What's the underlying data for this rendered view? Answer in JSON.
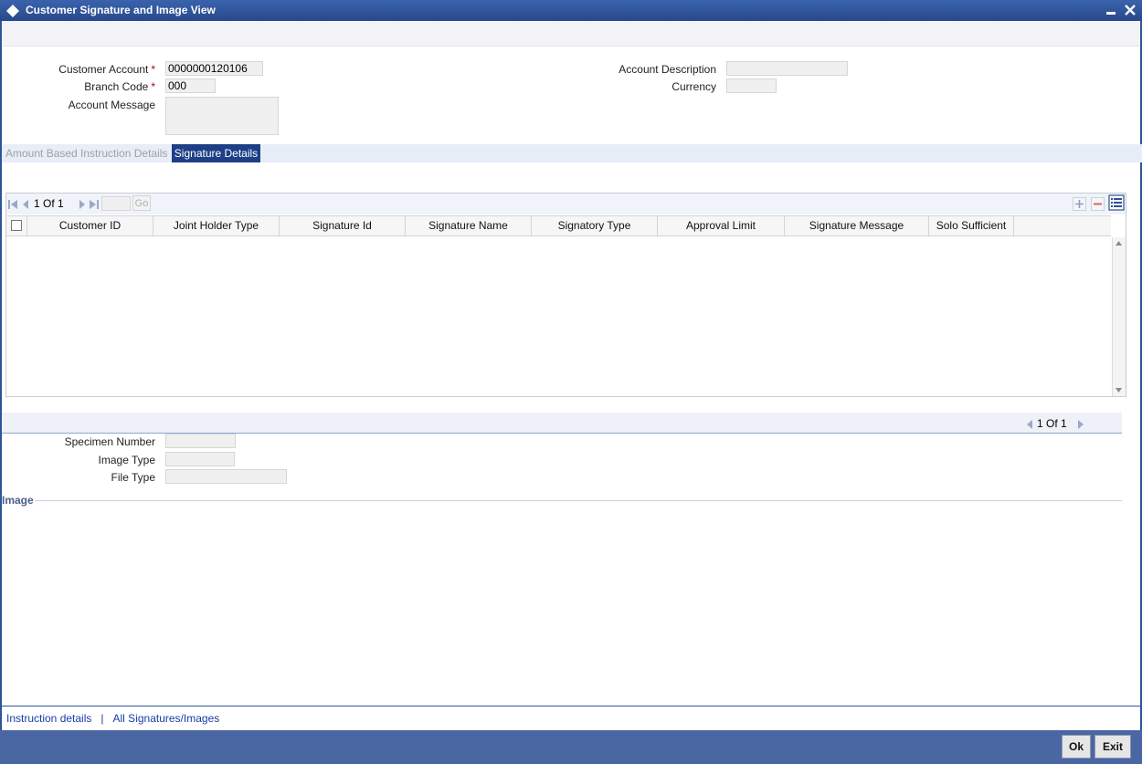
{
  "window": {
    "title": "Customer Signature and Image View",
    "accent_color": "#2f5597"
  },
  "form": {
    "customer_account": {
      "label": "Customer Account",
      "value": "0000000120106",
      "required_mark": "*"
    },
    "branch_code": {
      "label": "Branch Code",
      "value": "000",
      "required_mark": "*"
    },
    "account_message": {
      "label": "Account Message",
      "value": ""
    },
    "account_description": {
      "label": "Account Description",
      "value": ""
    },
    "currency": {
      "label": "Currency",
      "value": ""
    }
  },
  "tabs": [
    {
      "label": "Amount Based Instruction Details",
      "active": false
    },
    {
      "label": "Signature Details",
      "active": true
    }
  ],
  "grid": {
    "page_current": "1",
    "page_of": "Of",
    "page_total": "1",
    "page_input": "",
    "go_label": "Go",
    "columns": [
      "Customer ID",
      "Joint Holder Type",
      "Signature Id",
      "Signature Name",
      "Signatory Type",
      "Approval Limit",
      "Signature Message",
      "Solo Sufficient"
    ],
    "rows": []
  },
  "image_section": {
    "page_current": "1",
    "page_of": "Of",
    "page_total": "1",
    "specimen_number": {
      "label": "Specimen Number",
      "value": ""
    },
    "image_type": {
      "label": "Image Type",
      "value": ""
    },
    "file_type": {
      "label": "File Type",
      "value": ""
    },
    "image_legend": "Image"
  },
  "footer": {
    "links": [
      "Instruction details",
      "All Signatures/Images"
    ],
    "separator": "|",
    "ok_label": "Ok",
    "exit_label": "Exit"
  }
}
